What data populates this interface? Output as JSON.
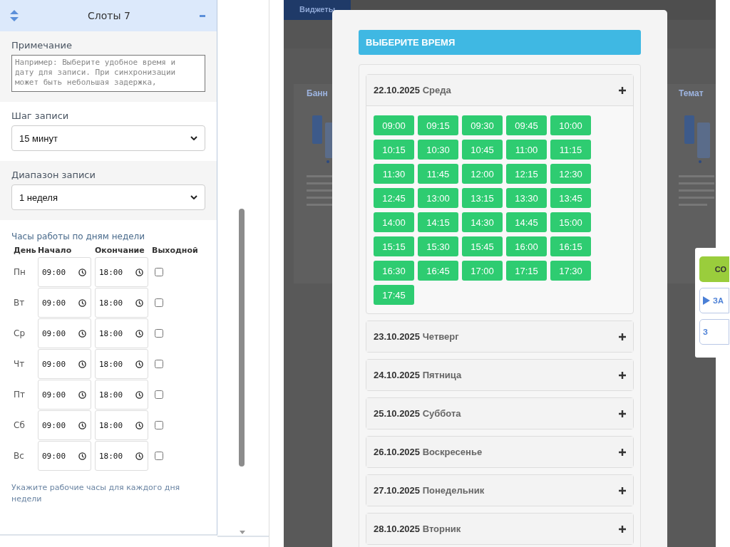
{
  "sidebar": {
    "title": "Слоты 7",
    "note": {
      "label": "Примечание",
      "placeholder": "Например: Выберите удобное время и дату для записи. При синхронизации может быть небольшая задержка,"
    },
    "step": {
      "label": "Шаг записи",
      "value": "15 минут"
    },
    "range": {
      "label": "Диапазон записи",
      "value": "1 неделя"
    },
    "hours": {
      "label": "Часы работы по дням недели",
      "columns": [
        "День",
        "Начало",
        "Окончание",
        "Выходной"
      ],
      "rows": [
        {
          "day": "Пн",
          "start": "09:00",
          "end": "18:00",
          "day_off": false
        },
        {
          "day": "Вт",
          "start": "09:00",
          "end": "18:00",
          "day_off": false
        },
        {
          "day": "Ср",
          "start": "09:00",
          "end": "18:00",
          "day_off": false
        },
        {
          "day": "Чт",
          "start": "09:00",
          "end": "18:00",
          "day_off": false
        },
        {
          "day": "Пт",
          "start": "09:00",
          "end": "18:00",
          "day_off": false
        },
        {
          "day": "Сб",
          "start": "09:00",
          "end": "18:00",
          "day_off": false
        },
        {
          "day": "Вс",
          "start": "09:00",
          "end": "18:00",
          "day_off": false
        }
      ],
      "hint": "Укажите рабочие часы для каждого дня недели"
    }
  },
  "background": {
    "tabs": [
      {
        "label": "Виджеты",
        "selected": true
      }
    ],
    "cards": [
      {
        "title": "Банн"
      },
      {
        "title": "Темат"
      }
    ]
  },
  "modal": {
    "title": "ВЫБЕРИТЕ ВРЕМЯ",
    "days": [
      {
        "date": "22.10.2025",
        "weekday": "Среда",
        "expanded": true,
        "slots": [
          "09:00",
          "09:15",
          "09:30",
          "09:45",
          "10:00",
          "10:15",
          "10:30",
          "10:45",
          "11:00",
          "11:15",
          "11:30",
          "11:45",
          "12:00",
          "12:15",
          "12:30",
          "12:45",
          "13:00",
          "13:15",
          "13:30",
          "13:45",
          "14:00",
          "14:15",
          "14:30",
          "14:45",
          "15:00",
          "15:15",
          "15:30",
          "15:45",
          "16:00",
          "16:15",
          "16:30",
          "16:45",
          "17:00",
          "17:15",
          "17:30",
          "17:45"
        ]
      },
      {
        "date": "23.10.2025",
        "weekday": "Четверг",
        "expanded": false
      },
      {
        "date": "24.10.2025",
        "weekday": "Пятница",
        "expanded": false
      },
      {
        "date": "25.10.2025",
        "weekday": "Суббота",
        "expanded": false
      },
      {
        "date": "26.10.2025",
        "weekday": "Воскресенье",
        "expanded": false
      },
      {
        "date": "27.10.2025",
        "weekday": "Понедельник",
        "expanded": false
      },
      {
        "date": "28.10.2025",
        "weekday": "Вторник",
        "expanded": false
      }
    ]
  },
  "side_panel": {
    "buttons": [
      {
        "label": "СО",
        "kind": "primary"
      },
      {
        "label": "ЗА",
        "kind": "play"
      },
      {
        "label": "З",
        "kind": "outline"
      }
    ]
  }
}
